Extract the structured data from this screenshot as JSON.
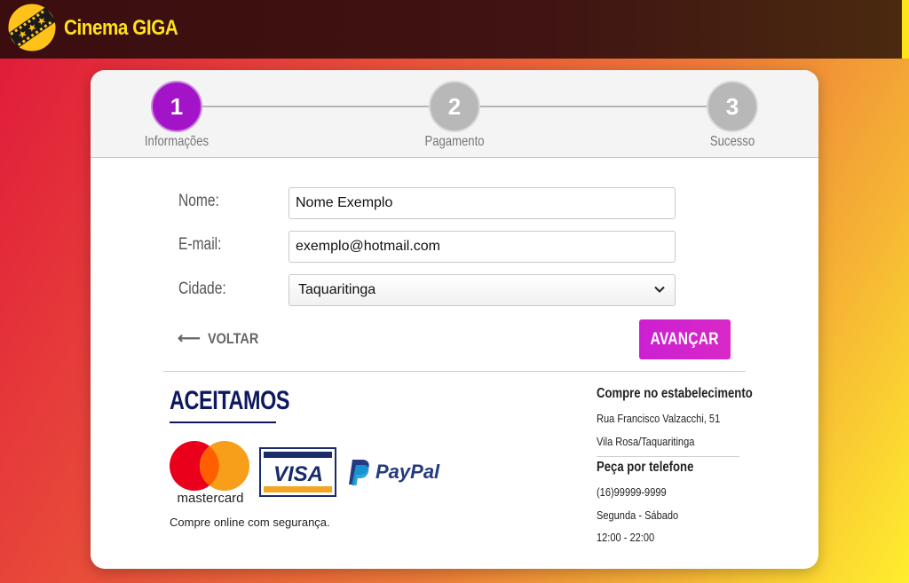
{
  "header": {
    "brand": "Cinema GIGA"
  },
  "steps": [
    {
      "number": "1",
      "label": "Informações",
      "active": true
    },
    {
      "number": "2",
      "label": "Pagamento",
      "active": false
    },
    {
      "number": "3",
      "label": "Sucesso",
      "active": false
    }
  ],
  "form": {
    "name_label": "Nome:",
    "name_value": "Nome Exemplo",
    "email_label": "E-mail:",
    "email_value": "exemplo@hotmail.com",
    "city_label": "Cidade:",
    "city_value": "Taquaritinga"
  },
  "actions": {
    "back_label": "VOLTAR",
    "next_label": "AVANÇAR"
  },
  "payments": {
    "title": "ACEITAMOS",
    "mastercard": "mastercard",
    "visa": "VISA",
    "paypal": "PayPal",
    "secure_note": "Compre online com segurança."
  },
  "contact": {
    "store_heading": "Compre no estabelecimento",
    "address_line1": "Rua Francisco Valzacchi, 51",
    "address_line2": "Vila Rosa/Taquaritinga",
    "phone_heading": "Peça por telefone",
    "phone": "(16)99999-9999",
    "days": "Segunda - Sábado",
    "hours": "12:00 - 22:00"
  },
  "colors": {
    "accent": "#a314c8",
    "button": "#d829c7",
    "brand_yellow": "#ffe21a",
    "navy": "#0d1860"
  }
}
